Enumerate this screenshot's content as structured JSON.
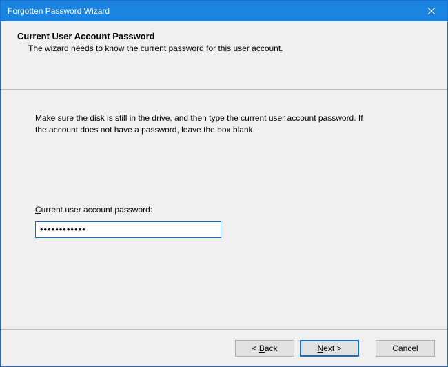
{
  "window": {
    "title": "Forgotten Password Wizard"
  },
  "header": {
    "heading": "Current User Account Password",
    "sub": "The wizard needs to know the current password for this user account."
  },
  "content": {
    "instructions": "Make sure the disk is still in the drive, and then type the current user account password. If the account does not have a password, leave the box blank.",
    "field_label_pre": "C",
    "field_label_rest": "urrent user account password:",
    "password_value": "••••••••••••"
  },
  "buttons": {
    "back": {
      "pre": "< ",
      "accel": "B",
      "post": "ack"
    },
    "next": {
      "pre": "",
      "accel": "N",
      "post": "ext >"
    },
    "cancel": "Cancel"
  }
}
